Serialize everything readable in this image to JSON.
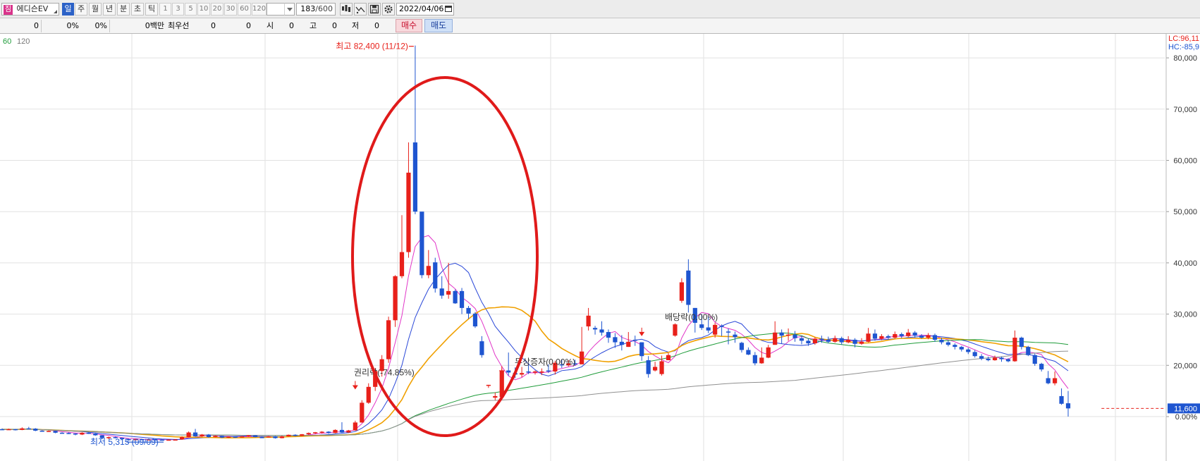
{
  "toolbar": {
    "stock_badge": "짐",
    "stock_name": "에디슨EV",
    "periods": [
      "일",
      "주",
      "월",
      "년",
      "분",
      "초",
      "틱"
    ],
    "active_period": "일",
    "intervals": [
      "1",
      "3",
      "5",
      "10",
      "20",
      "30",
      "60",
      "120"
    ],
    "count_value": "183",
    "count_total": "/600",
    "date_value": "2022/04/06"
  },
  "quote": {
    "v1": "0",
    "v2": "0%",
    "v3": "0%",
    "v4": "0백만",
    "best_label": "최우선",
    "best_value": "0",
    "v6": "0",
    "open_label": "시",
    "open_value": "0",
    "high_label": "고",
    "high_value": "0",
    "low_label": "저",
    "low_value": "0",
    "buy_label": "매수",
    "sell_label": "매도"
  },
  "colors": {
    "up": "#e8201a",
    "down": "#1e55d0",
    "ma5": "#e135c8",
    "ma10": "#2a48d8",
    "ma20": "#f0a000",
    "ma60": "#1f9c3a",
    "ma120": "#909090",
    "highlight_ellipse": "#e01a1a"
  },
  "chart_data": {
    "type": "candlestick",
    "y_axis": {
      "min": 0,
      "max": 90000,
      "ticks": [
        "0.00%",
        "20,000",
        "30,000",
        "40,000",
        "50,000",
        "60,000",
        "70,000",
        "80,000"
      ],
      "scale_note_lc": "LC:96,11",
      "scale_note_hc": "HC:-85,9"
    },
    "legend": [
      "60",
      "120"
    ],
    "annotations": {
      "high": "최고 82,400 (11/12)",
      "low": "최저 5,315 (09/09)",
      "rights": "권리락(-74.85%)",
      "dividend": "배당락(0.00%)",
      "bonus_issue": "무상증자(0.00%)"
    },
    "current_price": "11,600",
    "candles": [
      [
        7550,
        7500,
        7700,
        7350
      ],
      [
        7500,
        7550,
        7650,
        7400
      ],
      [
        7550,
        7400,
        7600,
        7300
      ],
      [
        7400,
        7700,
        7900,
        7350
      ],
      [
        7700,
        7650,
        8000,
        7550
      ],
      [
        7650,
        7250,
        7750,
        7150
      ],
      [
        7250,
        7150,
        7350,
        7050
      ],
      [
        7150,
        7200,
        7300,
        7050
      ],
      [
        7200,
        6850,
        7250,
        6750
      ],
      [
        6850,
        6800,
        6950,
        6700
      ],
      [
        6800,
        6700,
        6900,
        6600
      ],
      [
        6700,
        6500,
        6750,
        6350
      ],
      [
        6500,
        6850,
        6950,
        6400
      ],
      [
        6850,
        6700,
        6950,
        6600
      ],
      [
        6700,
        6350,
        6750,
        6250
      ],
      [
        6350,
        5800,
        6400,
        5700
      ],
      [
        5800,
        6000,
        6100,
        5600
      ],
      [
        6000,
        5850,
        6100,
        5750
      ],
      [
        5850,
        5600,
        5900,
        5450
      ],
      [
        5600,
        5400,
        5650,
        5300
      ],
      [
        5400,
        5600,
        5700,
        5350
      ],
      [
        5600,
        5450,
        5650,
        5380
      ],
      [
        5450,
        5550,
        5650,
        5400
      ],
      [
        5550,
        5500,
        5650,
        5400
      ],
      [
        5500,
        5450,
        5600,
        5380
      ],
      [
        5450,
        5500,
        5600,
        5380
      ],
      [
        5500,
        5530,
        5600,
        5450
      ],
      [
        5530,
        6000,
        6150,
        5480
      ],
      [
        6000,
        6900,
        7100,
        5950
      ],
      [
        6900,
        6150,
        7600,
        6050
      ],
      [
        6150,
        6500,
        6600,
        6000
      ],
      [
        6500,
        6000,
        6600,
        5900
      ],
      [
        6000,
        6250,
        6350,
        5950
      ],
      [
        6250,
        5900,
        6300,
        5800
      ],
      [
        5900,
        6100,
        6150,
        5850
      ],
      [
        6100,
        5950,
        6150,
        5850
      ],
      [
        5950,
        6150,
        6200,
        5900
      ],
      [
        6150,
        6350,
        6400,
        6050
      ],
      [
        6350,
        6000,
        6400,
        5950
      ],
      [
        6000,
        5950,
        6100,
        5900
      ],
      [
        5950,
        6150,
        6200,
        5900
      ],
      [
        6150,
        5800,
        6200,
        5700
      ],
      [
        5800,
        6150,
        6250,
        5750
      ],
      [
        6150,
        6450,
        6500,
        6100
      ],
      [
        6450,
        6250,
        6550,
        6150
      ],
      [
        6250,
        6550,
        6600,
        6200
      ],
      [
        6550,
        6800,
        6900,
        6450
      ],
      [
        6800,
        6950,
        7000,
        6600
      ],
      [
        6950,
        7050,
        7150,
        6700
      ],
      [
        7050,
        6800,
        7150,
        6650
      ],
      [
        6800,
        7400,
        7500,
        6750
      ],
      [
        7400,
        6900,
        8900,
        6800
      ],
      [
        6900,
        7300,
        7400,
        6800
      ],
      [
        7300,
        8850,
        9200,
        7250
      ],
      [
        8850,
        12700,
        13200,
        8800
      ],
      [
        12700,
        15800,
        16500,
        12500
      ],
      [
        15800,
        18900,
        19500,
        15000
      ],
      [
        18900,
        21200,
        22000,
        17800
      ],
      [
        21200,
        28800,
        29500,
        20500
      ],
      [
        28800,
        37400,
        37600,
        27500
      ],
      [
        37400,
        42100,
        49300,
        37000
      ],
      [
        42100,
        57600,
        63500,
        41000
      ],
      [
        63500,
        50000,
        82400,
        49500
      ],
      [
        50000,
        37600,
        48800,
        37000
      ],
      [
        37600,
        39400,
        42500,
        37000
      ],
      [
        40100,
        35000,
        41000,
        34200
      ],
      [
        35000,
        33600,
        37400,
        33000
      ],
      [
        33800,
        34500,
        40000,
        33000
      ],
      [
        34500,
        32100,
        34800,
        32000
      ],
      [
        34500,
        31200,
        35100,
        30000
      ],
      [
        31200,
        30100,
        31600,
        29100
      ],
      [
        30100,
        27600,
        30400,
        27300
      ],
      [
        24700,
        22000,
        25700,
        21500
      ],
      [
        16000,
        16200,
        16200,
        15600
      ],
      [
        13700,
        14000,
        14700,
        13200
      ],
      [
        13800,
        18900,
        19300,
        13600
      ],
      [
        19000,
        18600,
        22500,
        18000
      ],
      [
        18500,
        18200,
        19600,
        17500
      ],
      [
        18200,
        18500,
        19700,
        17700
      ],
      [
        18800,
        18600,
        20500,
        18300
      ],
      [
        18600,
        18800,
        19000,
        18200
      ],
      [
        18800,
        18800,
        19400,
        18100
      ],
      [
        19000,
        18800,
        20200,
        18500
      ],
      [
        18800,
        20500,
        20900,
        18200
      ],
      [
        20200,
        20000,
        21100,
        19500
      ],
      [
        20000,
        20400,
        21000,
        19800
      ],
      [
        20400,
        20200,
        21100,
        19900
      ],
      [
        20200,
        22700,
        27500,
        21000
      ],
      [
        27600,
        29700,
        31200,
        26800
      ],
      [
        27300,
        27000,
        27700,
        26000
      ],
      [
        27000,
        26400,
        28600,
        25800
      ],
      [
        26500,
        25400,
        27000,
        24400
      ],
      [
        25500,
        24500,
        26300,
        23400
      ],
      [
        24600,
        24000,
        25900,
        22900
      ],
      [
        23600,
        24600,
        26500,
        23600
      ],
      [
        25000,
        24800,
        25800,
        23800
      ],
      [
        24500,
        21800,
        24500,
        20900
      ],
      [
        21000,
        18300,
        21800,
        17600
      ],
      [
        19000,
        19700,
        20700,
        18800
      ],
      [
        18300,
        20800,
        21900,
        18000
      ],
      [
        21000,
        22000,
        22400,
        21000
      ],
      [
        25800,
        28000,
        28200,
        25600
      ],
      [
        32600,
        36200,
        37000,
        32200
      ],
      [
        38500,
        31800,
        40700,
        30300
      ],
      [
        31200,
        28300,
        31200,
        26400
      ],
      [
        28000,
        27300,
        30000,
        26900
      ],
      [
        27400,
        26800,
        29600,
        26300
      ],
      [
        26000,
        27900,
        28300,
        25400
      ],
      [
        27700,
        27600,
        28000,
        25700
      ],
      [
        26600,
        26400,
        27200,
        24100
      ],
      [
        26000,
        25500,
        26600,
        24400
      ],
      [
        24400,
        23000,
        24600,
        22500
      ],
      [
        23000,
        22100,
        23500,
        22000
      ],
      [
        22000,
        20400,
        22600,
        20000
      ],
      [
        20400,
        21500,
        23500,
        20300
      ],
      [
        21500,
        23500,
        24000,
        21400
      ],
      [
        24000,
        26400,
        28600,
        24000
      ],
      [
        26400,
        25800,
        27000,
        24200
      ],
      [
        25800,
        26000,
        27200,
        24800
      ],
      [
        26000,
        25300,
        26700,
        24600
      ],
      [
        25300,
        24800,
        25800,
        24100
      ],
      [
        24800,
        24300,
        25200,
        23800
      ],
      [
        24300,
        25200,
        25500,
        24000
      ],
      [
        25200,
        25000,
        25800,
        24400
      ],
      [
        25000,
        24600,
        25600,
        24300
      ],
      [
        24600,
        25300,
        25800,
        24400
      ],
      [
        25300,
        24500,
        25600,
        24000
      ],
      [
        24500,
        25000,
        25700,
        24300
      ],
      [
        25000,
        24200,
        25300,
        23500
      ],
      [
        24200,
        24600,
        25300,
        24000
      ],
      [
        24600,
        26200,
        27300,
        24500
      ],
      [
        26200,
        25200,
        27000,
        24800
      ],
      [
        25200,
        25700,
        26100,
        24900
      ],
      [
        25700,
        25400,
        26000,
        25000
      ],
      [
        25400,
        26100,
        26600,
        25200
      ],
      [
        26100,
        25700,
        26400,
        25300
      ],
      [
        25700,
        26400,
        27100,
        25500
      ],
      [
        26400,
        25800,
        26700,
        25400
      ],
      [
        25800,
        25400,
        26100,
        25200
      ],
      [
        25400,
        25900,
        26300,
        25100
      ],
      [
        25900,
        25000,
        26200,
        24600
      ],
      [
        25000,
        24500,
        25400,
        24100
      ],
      [
        24500,
        24000,
        24800,
        23700
      ],
      [
        24000,
        23600,
        24300,
        23100
      ],
      [
        23600,
        23100,
        23800,
        22700
      ],
      [
        23100,
        22600,
        23400,
        22200
      ],
      [
        22600,
        21800,
        23000,
        21500
      ],
      [
        21800,
        21300,
        22200,
        21000
      ],
      [
        21300,
        21000,
        21700,
        20800
      ],
      [
        21000,
        21500,
        21900,
        20900
      ],
      [
        21500,
        21200,
        21700,
        20700
      ],
      [
        21200,
        20800,
        21400,
        20600
      ],
      [
        20800,
        25400,
        26800,
        20700
      ],
      [
        25400,
        23600,
        25600,
        23100
      ],
      [
        23600,
        22000,
        23800,
        21800
      ],
      [
        22000,
        20300,
        22300,
        19900
      ],
      [
        20300,
        19200,
        20500,
        18800
      ],
      [
        17500,
        16500,
        18900,
        16300
      ],
      [
        16500,
        17500,
        18800,
        16100
      ],
      [
        14000,
        12500,
        15500,
        12300
      ],
      [
        12600,
        11600,
        15000,
        10000
      ]
    ],
    "moving_averages": [
      "MA5",
      "MA10",
      "MA20",
      "MA60",
      "MA120"
    ]
  }
}
